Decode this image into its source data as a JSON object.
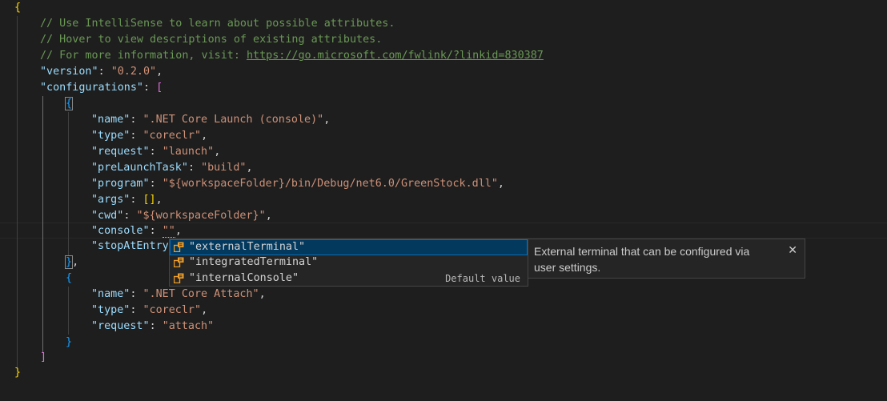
{
  "code": {
    "open_brace": "{",
    "comment1": "// Use IntelliSense to learn about possible attributes.",
    "comment2": "// Hover to view descriptions of existing attributes.",
    "comment3_prefix": "// For more information, visit: ",
    "comment3_link": "https://go.microsoft.com/fwlink/?linkid=830387",
    "version_key": "\"version\"",
    "version_val": "\"0.2.0\"",
    "configurations_key": "\"configurations\"",
    "cfg1": {
      "name_key": "\"name\"",
      "name_val": "\".NET Core Launch (console)\"",
      "type_key": "\"type\"",
      "type_val": "\"coreclr\"",
      "request_key": "\"request\"",
      "request_val": "\"launch\"",
      "prelaunch_key": "\"preLaunchTask\"",
      "prelaunch_val": "\"build\"",
      "program_key": "\"program\"",
      "program_val": "\"${workspaceFolder}/bin/Debug/net6.0/GreenStock.dll\"",
      "args_key": "\"args\"",
      "args_val": "[]",
      "cwd_key": "\"cwd\"",
      "cwd_val": "\"${workspaceFolder}\"",
      "console_key": "\"console\"",
      "console_val": "\"\"",
      "stop_key": "\"stopAtEntry"
    },
    "cfg2": {
      "name_key": "\"name\"",
      "name_val": "\".NET Core Attach\"",
      "type_key": "\"type\"",
      "type_val": "\"coreclr\"",
      "request_key": "\"request\"",
      "request_val": "\"attach\""
    }
  },
  "suggest": {
    "items": [
      {
        "label": "\"externalTerminal\"",
        "detail": ""
      },
      {
        "label": "\"integratedTerminal\"",
        "detail": ""
      },
      {
        "label": "\"internalConsole\"",
        "detail": "Default value"
      }
    ],
    "icon": "enum-member-icon",
    "icon_color": "#ee9d28"
  },
  "docs": {
    "text": "External terminal that can be configured via user settings.",
    "close_glyph": "✕"
  }
}
